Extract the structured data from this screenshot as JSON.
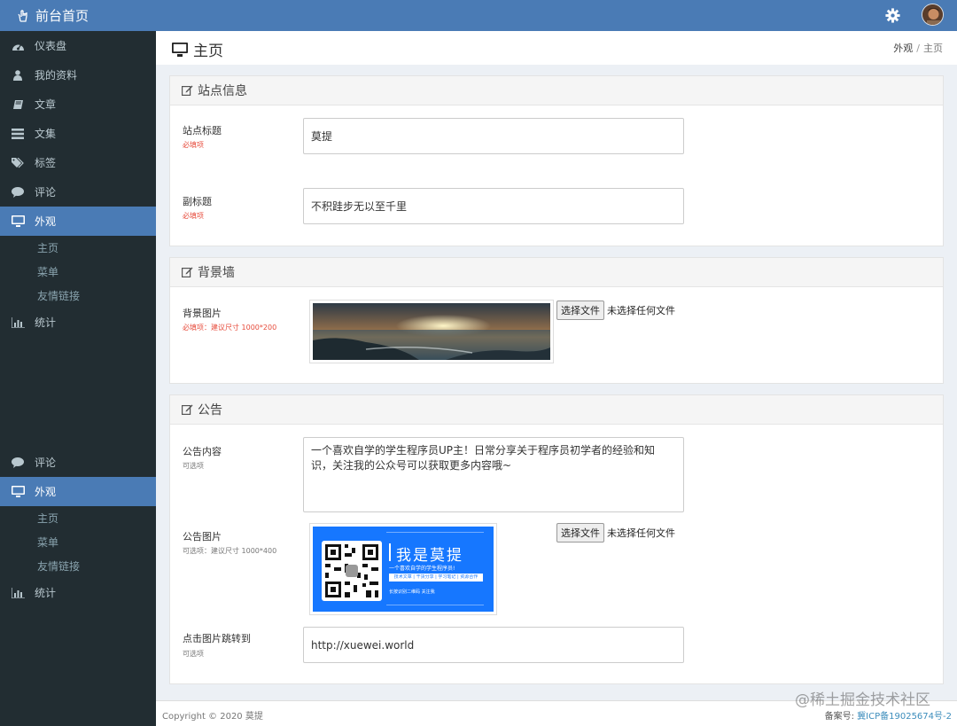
{
  "app": {
    "title": "前台首页"
  },
  "sidebar": {
    "items": [
      {
        "label": "仪表盘",
        "icon": "dashboard-icon"
      },
      {
        "label": "我的资料",
        "icon": "user-icon"
      },
      {
        "label": "文章",
        "icon": "book-icon"
      },
      {
        "label": "文集",
        "icon": "list-icon"
      },
      {
        "label": "标签",
        "icon": "tags-icon"
      },
      {
        "label": "评论",
        "icon": "comment-icon"
      },
      {
        "label": "外观",
        "icon": "monitor-icon",
        "active": true
      },
      {
        "label": "统计",
        "icon": "bar-chart-icon"
      }
    ],
    "sub_items": [
      "主页",
      "菜单",
      "友情链接"
    ],
    "repeat_items": [
      {
        "label": "评论",
        "icon": "comment-icon"
      },
      {
        "label": "外观",
        "icon": "monitor-icon",
        "active": true
      },
      {
        "label": "统计",
        "icon": "bar-chart-icon"
      }
    ]
  },
  "header": {
    "title": "主页",
    "breadcrumb": [
      "外观",
      "主页"
    ]
  },
  "site_info": {
    "title": "站点信息",
    "site_title_label": "站点标题",
    "site_title_hint": "必填项",
    "site_title_value": "莫提",
    "subtitle_label": "副标题",
    "subtitle_hint": "必填项",
    "subtitle_value": "不积跬步无以至千里"
  },
  "background": {
    "title": "背景墙",
    "image_label": "背景图片",
    "image_hint": "必填项：建议尺寸 1000*200",
    "file_button": "选择文件",
    "file_status": "未选择任何文件"
  },
  "notice": {
    "title": "公告",
    "content_label": "公告内容",
    "content_hint": "可选项",
    "content_value": "一个喜欢自学的学生程序员UP主！日常分享关于程序员初学者的经验和知识，关注我的公众号可以获取更多内容哦~",
    "image_label": "公告图片",
    "image_hint": "可选项：建议尺寸 1000*400",
    "file_button": "选择文件",
    "file_status": "未选择任何文件",
    "banner_title": "我是莫提",
    "banner_subtitle": "一个喜欢自学的学生程序员!",
    "banner_tags": "技术文章 | 干货分享 | 学习笔记 | 资源合作",
    "banner_footer": "长按识别二维码 关注我",
    "link_label": "点击图片跳转到",
    "link_hint": "可选项",
    "link_value": "http://xuewei.world"
  },
  "footer": {
    "copyright": "Copyright © 2020 莫提",
    "icp_label": "备案号: ",
    "icp_value": "冀ICP备19025674号-2"
  },
  "watermark": "@稀土掘金技术社区",
  "colors": {
    "topbar": "#4a7bb5",
    "sidebar": "#222d32",
    "active": "#4a7bb5",
    "required": "#e74c3c",
    "banner": "#1677ff"
  }
}
